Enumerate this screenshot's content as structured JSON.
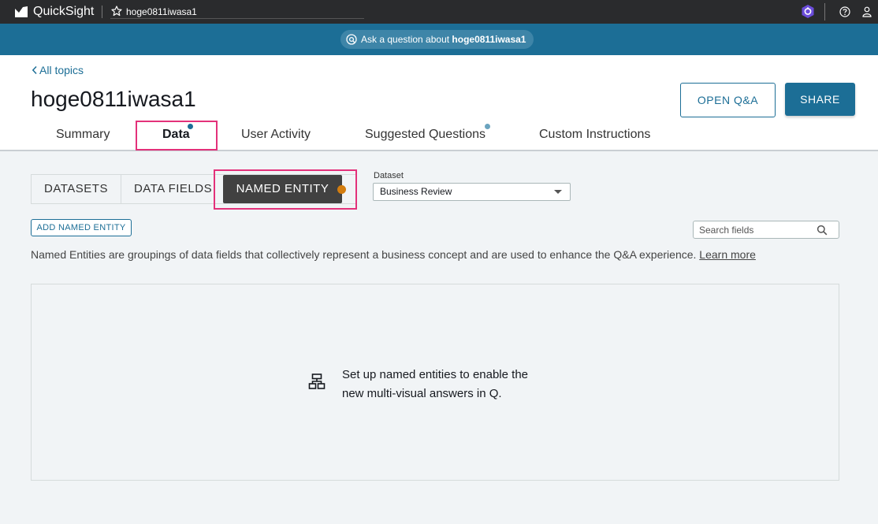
{
  "topbar": {
    "app_name": "QuickSight",
    "topic_name": "hoge0811iwasa1",
    "icons": [
      "quicksight-logo-icon",
      "star-icon",
      "extension-icon",
      "help-icon",
      "user-icon"
    ]
  },
  "askbar": {
    "prefix": "Ask a question about ",
    "topic": "hoge0811iwasa1"
  },
  "header": {
    "back_label": "All topics",
    "title": "hoge0811iwasa1",
    "open_qa_label": "OPEN Q&A",
    "share_label": "SHARE"
  },
  "tabs": [
    {
      "label": "Summary",
      "active": false
    },
    {
      "label": "Data",
      "active": true
    },
    {
      "label": "User Activity",
      "active": false
    },
    {
      "label": "Suggested Questions",
      "active": false
    },
    {
      "label": "Custom Instructions",
      "active": false
    }
  ],
  "subtabs": {
    "datasets": "DATASETS",
    "data_fields": "DATA FIELDS",
    "named_entity": "NAMED ENTITY"
  },
  "dataset": {
    "label": "Dataset",
    "selected": "Business Review"
  },
  "add_button": "ADD NAMED ENTITY",
  "search": {
    "placeholder": "Search fields",
    "value": ""
  },
  "description": {
    "text": "Named Entities are groupings of data fields that collectively represent a business concept and are used to enhance the Q&A experience. ",
    "link": "Learn more"
  },
  "empty_state": {
    "line1": "Set up named entities to enable the",
    "line2": "new multi-visual answers in Q."
  },
  "colors": {
    "topbar": "#2a2b2d",
    "askbar": "#1c6e96",
    "primary": "#1c6e96",
    "highlight": "#e3317a",
    "orange_dot": "#d37d0f"
  }
}
